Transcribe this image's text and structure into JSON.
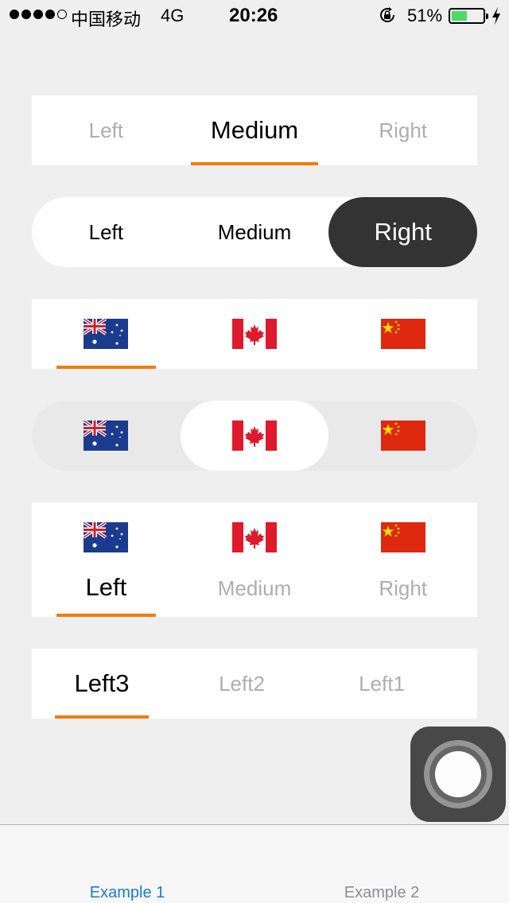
{
  "status_bar": {
    "carrier": "中国移动",
    "network": "4G",
    "time": "20:26",
    "battery_percent": "51%",
    "battery_level": 0.51,
    "signal_bars_filled": 4,
    "signal_bars_total": 5
  },
  "segments": {
    "seg1": {
      "labels": [
        "Left",
        "Medium",
        "Right"
      ],
      "selected": 1
    },
    "seg2": {
      "labels": [
        "Left",
        "Medium",
        "Right"
      ],
      "selected": 2
    },
    "seg3": {
      "flags": [
        "australia-flag",
        "canada-flag",
        "china-flag"
      ],
      "selected": 0
    },
    "seg4": {
      "flags": [
        "australia-flag",
        "canada-flag",
        "china-flag"
      ],
      "selected": 1
    },
    "seg5": {
      "flags": [
        "australia-flag",
        "canada-flag",
        "china-flag"
      ],
      "labels": [
        "Left",
        "Medium",
        "Right"
      ],
      "selected": 0
    },
    "seg6": {
      "labels": [
        "Left3",
        "Left2",
        "Left1"
      ],
      "selected": 0
    }
  },
  "tab_bar": {
    "tabs": [
      {
        "label": "Example 1",
        "active": true
      },
      {
        "label": "Example 2",
        "active": false
      }
    ]
  },
  "colors": {
    "accent_orange": "#f77a0d",
    "tab_active_blue": "#1a7bd8",
    "pill_dark": "#333333",
    "background": "#efeff0"
  }
}
